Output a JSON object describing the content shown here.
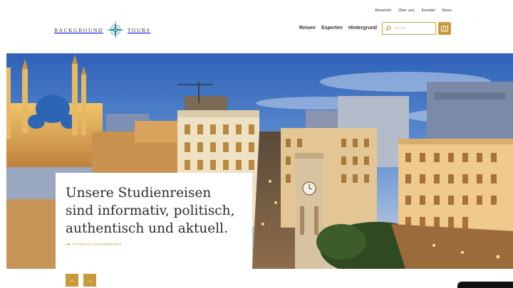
{
  "meta_nav": [
    "Reiseinfo",
    "Über uns",
    "Kontakt",
    "News"
  ],
  "logo": {
    "left_word": "BACKGROUND",
    "right_word": "TOURS"
  },
  "main_nav": [
    "Reisen",
    "Experten",
    "Hintergrund"
  ],
  "search": {
    "placeholder": "Suche"
  },
  "icons": {
    "search": "search-icon",
    "map": "map-icon",
    "compass": "compass-rose-icon",
    "prev": "arrow-left-icon",
    "next": "arrow-right-icon"
  },
  "hero": {
    "title": "Unsere Studienreisen sind informativ, politisch, authentisch und aktuell.",
    "link_label": "AKTUELLE STUDIENREISEN"
  },
  "slider": {
    "prev": "←",
    "next": "→"
  },
  "colors": {
    "accent": "#c99a3b",
    "text": "#2c2c2c"
  }
}
